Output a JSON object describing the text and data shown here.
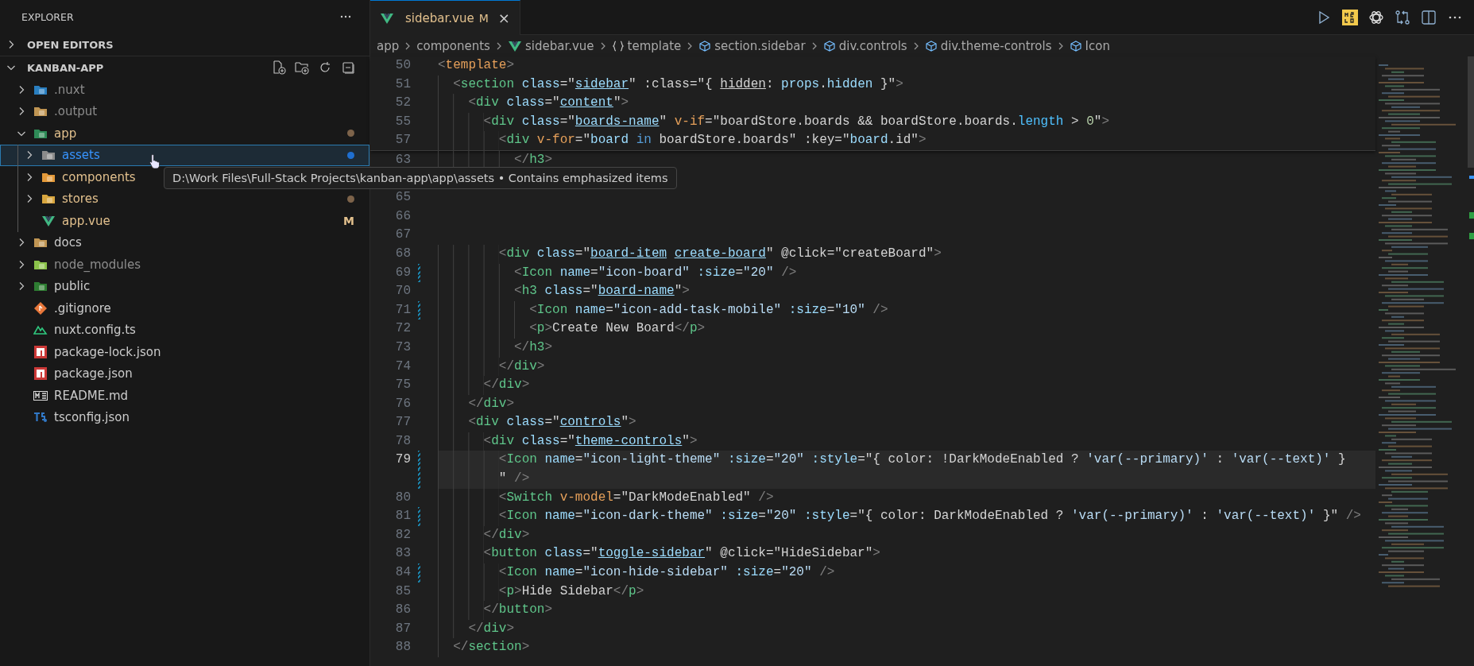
{
  "sidebar": {
    "title": "EXPLORER",
    "sections": [
      {
        "label": "OPEN EDITORS",
        "expanded": false
      },
      {
        "label": "KANBAN-APP",
        "expanded": true
      }
    ],
    "tree": [
      {
        "name": ".nuxt",
        "kind": "nuxt-folder",
        "expanded": false,
        "selected": false,
        "color": "#8c8c8c"
      },
      {
        "name": ".output",
        "kind": "plain-folder",
        "expanded": false,
        "selected": false,
        "color": "#8c8c8c"
      },
      {
        "name": "app",
        "kind": "app-folder",
        "expanded": true,
        "selected": false,
        "color": "#e2c08d",
        "dot": {
          "color": "#7d634a"
        },
        "children": [
          {
            "name": "assets",
            "kind": "assets-folder",
            "expanded": false,
            "selected": true,
            "color": "#3794ff",
            "dot": {
              "color": "#1f6fd0"
            }
          },
          {
            "name": "components",
            "kind": "components-folder",
            "expanded": false,
            "selected": false,
            "color": "#e2c08d"
          },
          {
            "name": "stores",
            "kind": "stores-folder",
            "expanded": false,
            "selected": false,
            "color": "#e2c08d",
            "dot": {
              "color": "#7d634a"
            }
          },
          {
            "name": "app.vue",
            "kind": "vue",
            "selected": false,
            "color": "#e2c08d",
            "badge": "M"
          }
        ]
      },
      {
        "name": "docs",
        "kind": "docs-folder",
        "expanded": false,
        "selected": false,
        "color": "#cccccc"
      },
      {
        "name": "node_modules",
        "kind": "node-folder",
        "expanded": false,
        "selected": false,
        "color": "#8c8c8c"
      },
      {
        "name": "public",
        "kind": "public-folder",
        "expanded": false,
        "selected": false,
        "color": "#cccccc"
      },
      {
        "name": ".gitignore",
        "kind": "git",
        "selected": false,
        "color": "#cccccc"
      },
      {
        "name": "nuxt.config.ts",
        "kind": "nuxt",
        "selected": false,
        "color": "#cccccc"
      },
      {
        "name": "package-lock.json",
        "kind": "npm",
        "selected": false,
        "color": "#cccccc"
      },
      {
        "name": "package.json",
        "kind": "npm",
        "selected": false,
        "color": "#cccccc"
      },
      {
        "name": "README.md",
        "kind": "markdown",
        "selected": false,
        "color": "#cccccc"
      },
      {
        "name": "tsconfig.json",
        "kind": "tsconfig",
        "selected": false,
        "color": "#cccccc"
      }
    ],
    "tooltip": "D:\\Work Files\\Full-Stack Projects\\kanban-app\\app\\assets • Contains emphasized items"
  },
  "tabs": [
    {
      "label": "sidebar.vue",
      "badge": "M",
      "selected": true,
      "close": "×"
    }
  ],
  "breadcrumbs": [
    {
      "text": "app",
      "kind": "folder"
    },
    {
      "text": "components",
      "kind": "folder"
    },
    {
      "text": "sidebar.vue",
      "kind": "vue"
    },
    {
      "text": "template",
      "kind": "braces"
    },
    {
      "text": "section.sidebar",
      "kind": "element"
    },
    {
      "text": "div.controls",
      "kind": "element"
    },
    {
      "text": "div.theme-controls",
      "kind": "element"
    },
    {
      "text": "Icon",
      "kind": "element"
    }
  ],
  "sticky_lines": [
    {
      "num": "50",
      "tokens": [
        {
          "kind": "punct",
          "text": "<"
        },
        {
          "kind": "template-tag",
          "text": "template"
        },
        {
          "kind": "punct",
          "text": ">"
        }
      ]
    },
    {
      "num": "51",
      "tokens": [
        {
          "kind": "punct",
          "text": "  <"
        },
        {
          "kind": "tag",
          "text": "section"
        },
        {
          "kind": "attr",
          "text": " class"
        },
        {
          "kind": "plain",
          "text": "=\""
        },
        {
          "kind": "class-ref",
          "text": "sidebar"
        },
        {
          "kind": "plain",
          "text": "\" :class=\"{ "
        },
        {
          "kind": "underlined",
          "text": "hidden"
        },
        {
          "kind": "plain",
          "text": ": "
        },
        {
          "kind": "variable",
          "text": "props"
        },
        {
          "kind": "plain",
          "text": "."
        },
        {
          "kind": "variable",
          "text": "hidden"
        },
        {
          "kind": "plain",
          "text": " }\""
        },
        {
          "kind": "punct",
          "text": ">"
        }
      ]
    },
    {
      "num": "52",
      "tokens": [
        {
          "kind": "punct",
          "text": "    <"
        },
        {
          "kind": "tag",
          "text": "div"
        },
        {
          "kind": "attr",
          "text": " class"
        },
        {
          "kind": "plain",
          "text": "=\""
        },
        {
          "kind": "class-ref",
          "text": "content"
        },
        {
          "kind": "plain",
          "text": "\""
        },
        {
          "kind": "punct",
          "text": ">"
        }
      ]
    },
    {
      "num": "55",
      "tokens": [
        {
          "kind": "punct",
          "text": "      <"
        },
        {
          "kind": "tag",
          "text": "div"
        },
        {
          "kind": "attr",
          "text": " class"
        },
        {
          "kind": "plain",
          "text": "=\""
        },
        {
          "kind": "class-ref",
          "text": "boards-name"
        },
        {
          "kind": "plain",
          "text": "\""
        },
        {
          "kind": "directive",
          "text": " v-if"
        },
        {
          "kind": "plain",
          "text": "=\"boardStore.boards && boardStore.boards."
        },
        {
          "kind": "property",
          "text": "length"
        },
        {
          "kind": "plain",
          "text": " > "
        },
        {
          "kind": "number",
          "text": "0"
        },
        {
          "kind": "plain",
          "text": "\""
        },
        {
          "kind": "punct",
          "text": ">"
        }
      ]
    },
    {
      "num": "57",
      "tokens": [
        {
          "kind": "punct",
          "text": "        <"
        },
        {
          "kind": "tag",
          "text": "div"
        },
        {
          "kind": "directive",
          "text": " v-for"
        },
        {
          "kind": "plain",
          "text": "=\""
        },
        {
          "kind": "variable",
          "text": "board"
        },
        {
          "kind": "keyword",
          "text": " in"
        },
        {
          "kind": "plain",
          "text": " boardStore.boards\" :key=\""
        },
        {
          "kind": "variable",
          "text": "board"
        },
        {
          "kind": "plain",
          "text": ".id\""
        },
        {
          "kind": "punct",
          "text": ">"
        }
      ]
    }
  ],
  "lines": [
    {
      "num": "63",
      "tokens": [
        {
          "kind": "punct",
          "text": "          </"
        },
        {
          "kind": "tag",
          "text": "h3"
        },
        {
          "kind": "punct",
          "text": ">"
        }
      ]
    },
    {
      "covered": true
    },
    {
      "num": "65"
    },
    {
      "num": "66"
    },
    {
      "num": "67"
    },
    {
      "num": "68",
      "tokens": [
        {
          "kind": "punct",
          "text": "        <"
        },
        {
          "kind": "tag",
          "text": "div"
        },
        {
          "kind": "attr",
          "text": " class"
        },
        {
          "kind": "plain",
          "text": "=\""
        },
        {
          "kind": "class-ref",
          "text": "board-item"
        },
        {
          "kind": "class-ref",
          "text": " create-board"
        },
        {
          "kind": "plain",
          "text": "\" @click=\"createBoard\""
        },
        {
          "kind": "punct",
          "text": ">"
        }
      ]
    },
    {
      "num": "69",
      "modified": true,
      "tokens": [
        {
          "kind": "punct",
          "text": "          <"
        },
        {
          "kind": "tag",
          "text": "Icon"
        },
        {
          "kind": "attr",
          "text": " name"
        },
        {
          "kind": "plain",
          "text": "="
        },
        {
          "kind": "string",
          "text": "\"icon-board\""
        },
        {
          "kind": "attr",
          "text": " :size"
        },
        {
          "kind": "plain",
          "text": "="
        },
        {
          "kind": "string",
          "text": "\"20\""
        },
        {
          "kind": "punct",
          "text": " />"
        }
      ]
    },
    {
      "num": "70",
      "tokens": [
        {
          "kind": "punct",
          "text": "          <"
        },
        {
          "kind": "tag",
          "text": "h3"
        },
        {
          "kind": "attr",
          "text": " class"
        },
        {
          "kind": "plain",
          "text": "=\""
        },
        {
          "kind": "class-ref",
          "text": "board-name"
        },
        {
          "kind": "plain",
          "text": "\""
        },
        {
          "kind": "punct",
          "text": ">"
        }
      ]
    },
    {
      "num": "71",
      "modified": true,
      "tokens": [
        {
          "kind": "punct",
          "text": "            <"
        },
        {
          "kind": "tag",
          "text": "Icon"
        },
        {
          "kind": "attr",
          "text": " name"
        },
        {
          "kind": "plain",
          "text": "="
        },
        {
          "kind": "string",
          "text": "\"icon-add-task-mobile\""
        },
        {
          "kind": "attr",
          "text": " :size"
        },
        {
          "kind": "plain",
          "text": "="
        },
        {
          "kind": "string",
          "text": "\"10\""
        },
        {
          "kind": "punct",
          "text": " />"
        }
      ]
    },
    {
      "num": "72",
      "tokens": [
        {
          "kind": "punct",
          "text": "            <"
        },
        {
          "kind": "tag",
          "text": "p"
        },
        {
          "kind": "punct",
          "text": ">"
        },
        {
          "kind": "plain",
          "text": "Create New Board"
        },
        {
          "kind": "punct",
          "text": "</"
        },
        {
          "kind": "tag",
          "text": "p"
        },
        {
          "kind": "punct",
          "text": ">"
        }
      ]
    },
    {
      "num": "73",
      "tokens": [
        {
          "kind": "punct",
          "text": "          </"
        },
        {
          "kind": "tag",
          "text": "h3"
        },
        {
          "kind": "punct",
          "text": ">"
        }
      ]
    },
    {
      "num": "74",
      "tokens": [
        {
          "kind": "punct",
          "text": "        </"
        },
        {
          "kind": "tag",
          "text": "div"
        },
        {
          "kind": "punct",
          "text": ">"
        }
      ]
    },
    {
      "num": "75",
      "tokens": [
        {
          "kind": "punct",
          "text": "      </"
        },
        {
          "kind": "tag",
          "text": "div"
        },
        {
          "kind": "punct",
          "text": ">"
        }
      ]
    },
    {
      "num": "76",
      "tokens": [
        {
          "kind": "punct",
          "text": "    </"
        },
        {
          "kind": "tag",
          "text": "div"
        },
        {
          "kind": "punct",
          "text": ">"
        }
      ]
    },
    {
      "num": "77",
      "tokens": [
        {
          "kind": "punct",
          "text": "    <"
        },
        {
          "kind": "tag",
          "text": "div"
        },
        {
          "kind": "attr",
          "text": " class"
        },
        {
          "kind": "plain",
          "text": "=\""
        },
        {
          "kind": "class-ref",
          "text": "controls"
        },
        {
          "kind": "plain",
          "text": "\""
        },
        {
          "kind": "punct",
          "text": ">"
        }
      ]
    },
    {
      "num": "78",
      "tokens": [
        {
          "kind": "punct",
          "text": "      <"
        },
        {
          "kind": "tag",
          "text": "div"
        },
        {
          "kind": "attr",
          "text": " class"
        },
        {
          "kind": "plain",
          "text": "=\""
        },
        {
          "kind": "class-ref",
          "text": "theme-controls"
        },
        {
          "kind": "plain",
          "text": "\""
        },
        {
          "kind": "punct",
          "text": ">"
        }
      ]
    },
    {
      "num": "79",
      "modified": true,
      "current": true,
      "tokens": [
        {
          "kind": "punct",
          "text": "        <"
        },
        {
          "kind": "tag",
          "text": "Icon"
        },
        {
          "kind": "attr",
          "text": " name"
        },
        {
          "kind": "plain",
          "text": "="
        },
        {
          "kind": "string",
          "text": "\"icon-light-theme\""
        },
        {
          "kind": "attr",
          "text": " :size"
        },
        {
          "kind": "plain",
          "text": "="
        },
        {
          "kind": "string",
          "text": "\"20\""
        },
        {
          "kind": "attr",
          "text": " :style"
        },
        {
          "kind": "plain",
          "text": "=\"{ color: !DarkModeEnabled ? "
        },
        {
          "kind": "string",
          "text": "'var(--primary)'"
        },
        {
          "kind": "plain",
          "text": " : "
        },
        {
          "kind": "string",
          "text": "'var(--text)'"
        },
        {
          "kind": "plain",
          "text": " }"
        }
      ],
      "continuation": [
        {
          "kind": "plain",
          "text": "        \""
        },
        {
          "kind": "punct",
          "text": " />"
        }
      ]
    },
    {
      "num": "80",
      "tokens": [
        {
          "kind": "punct",
          "text": "        <"
        },
        {
          "kind": "tag",
          "text": "Switch"
        },
        {
          "kind": "directive",
          "text": " v-model"
        },
        {
          "kind": "plain",
          "text": "=\"DarkModeEnabled\""
        },
        {
          "kind": "punct",
          "text": " />"
        }
      ]
    },
    {
      "num": "81",
      "modified": true,
      "tokens": [
        {
          "kind": "punct",
          "text": "        <"
        },
        {
          "kind": "tag",
          "text": "Icon"
        },
        {
          "kind": "attr",
          "text": " name"
        },
        {
          "kind": "plain",
          "text": "="
        },
        {
          "kind": "string",
          "text": "\"icon-dark-theme\""
        },
        {
          "kind": "attr",
          "text": " :size"
        },
        {
          "kind": "plain",
          "text": "="
        },
        {
          "kind": "string",
          "text": "\"20\""
        },
        {
          "kind": "attr",
          "text": " :style"
        },
        {
          "kind": "plain",
          "text": "=\"{ color: DarkModeEnabled ? "
        },
        {
          "kind": "string",
          "text": "'var(--primary)'"
        },
        {
          "kind": "plain",
          "text": " : "
        },
        {
          "kind": "string",
          "text": "'var(--text)'"
        },
        {
          "kind": "plain",
          "text": " }\""
        },
        {
          "kind": "punct",
          "text": " />"
        }
      ]
    },
    {
      "num": "82",
      "tokens": [
        {
          "kind": "punct",
          "text": "      </"
        },
        {
          "kind": "tag",
          "text": "div"
        },
        {
          "kind": "punct",
          "text": ">"
        }
      ]
    },
    {
      "num": "83",
      "tokens": [
        {
          "kind": "punct",
          "text": "      <"
        },
        {
          "kind": "tag",
          "text": "button"
        },
        {
          "kind": "attr",
          "text": " class"
        },
        {
          "kind": "plain",
          "text": "=\""
        },
        {
          "kind": "class-ref",
          "text": "toggle-sidebar"
        },
        {
          "kind": "plain",
          "text": "\" @click=\"HideSidebar\""
        },
        {
          "kind": "punct",
          "text": ">"
        }
      ]
    },
    {
      "num": "84",
      "modified": true,
      "tokens": [
        {
          "kind": "punct",
          "text": "        <"
        },
        {
          "kind": "tag",
          "text": "Icon"
        },
        {
          "kind": "attr",
          "text": " name"
        },
        {
          "kind": "plain",
          "text": "="
        },
        {
          "kind": "string",
          "text": "\"icon-hide-sidebar\""
        },
        {
          "kind": "attr",
          "text": " :size"
        },
        {
          "kind": "plain",
          "text": "="
        },
        {
          "kind": "string",
          "text": "\"20\""
        },
        {
          "kind": "punct",
          "text": " />"
        }
      ]
    },
    {
      "num": "85",
      "tokens": [
        {
          "kind": "punct",
          "text": "        <"
        },
        {
          "kind": "tag",
          "text": "p"
        },
        {
          "kind": "punct",
          "text": ">"
        },
        {
          "kind": "plain",
          "text": "Hide Sidebar"
        },
        {
          "kind": "punct",
          "text": "</"
        },
        {
          "kind": "tag",
          "text": "p"
        },
        {
          "kind": "punct",
          "text": ">"
        }
      ]
    },
    {
      "num": "86",
      "tokens": [
        {
          "kind": "punct",
          "text": "      </"
        },
        {
          "kind": "tag",
          "text": "button"
        },
        {
          "kind": "punct",
          "text": ">"
        }
      ]
    },
    {
      "num": "87",
      "tokens": [
        {
          "kind": "punct",
          "text": "    </"
        },
        {
          "kind": "tag",
          "text": "div"
        },
        {
          "kind": "punct",
          "text": ">"
        }
      ]
    },
    {
      "num": "88",
      "tokens": [
        {
          "kind": "punct",
          "text": "  </"
        },
        {
          "kind": "tag",
          "text": "section"
        },
        {
          "kind": "punct",
          "text": ">"
        }
      ]
    }
  ]
}
